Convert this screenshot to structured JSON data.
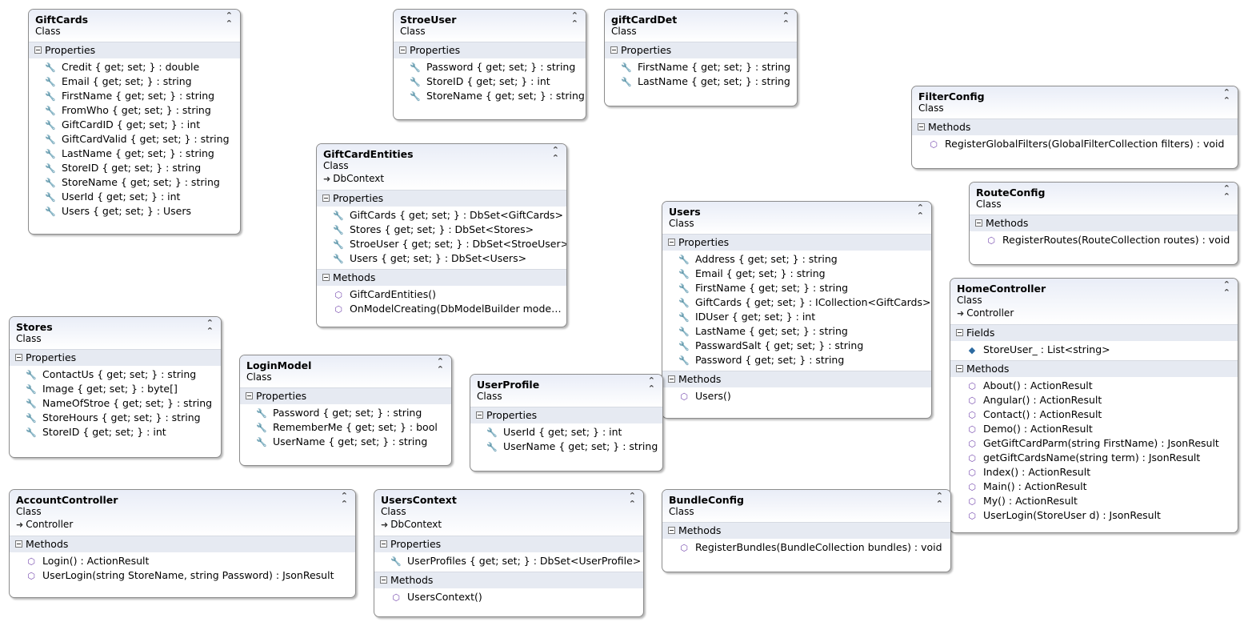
{
  "diagram": {
    "classes": [
      {
        "id": "giftcards",
        "name": "GiftCards",
        "stereotype": "Class",
        "base": "",
        "sections": [
          {
            "title": "Properties",
            "kind": "prop",
            "items": [
              "Credit { get; set; } : double",
              "Email { get; set; } : string",
              "FirstName { get; set; } : string",
              "FromWho { get; set; } : string",
              "GiftCardID { get; set; } : int",
              "GiftCardValid { get; set; } : string",
              "LastName { get; set; } : string",
              "StoreID { get; set; } : string",
              "StoreName { get; set; } : string",
              "UserId { get; set; } : int",
              "Users { get; set; } : Users"
            ]
          }
        ]
      },
      {
        "id": "stroeuser",
        "name": "StroeUser",
        "stereotype": "Class",
        "base": "",
        "sections": [
          {
            "title": "Properties",
            "kind": "prop",
            "items": [
              "Password { get; set; } : string",
              "StoreID { get; set; } : int",
              "StoreName { get; set; } : string"
            ]
          }
        ]
      },
      {
        "id": "giftcarddet",
        "name": "giftCardDet",
        "stereotype": "Class",
        "base": "",
        "sections": [
          {
            "title": "Properties",
            "kind": "privprop",
            "items": [
              "FirstName { get; set; } : string",
              "LastName { get; set; } : string"
            ]
          }
        ]
      },
      {
        "id": "filterconfig",
        "name": "FilterConfig",
        "stereotype": "Class",
        "base": "",
        "sections": [
          {
            "title": "Methods",
            "kind": "method",
            "items": [
              "RegisterGlobalFilters(GlobalFilterCollection filters) : void"
            ]
          }
        ]
      },
      {
        "id": "giftcardentities",
        "name": "GiftCardEntities",
        "stereotype": "Class",
        "base": "DbContext",
        "sections": [
          {
            "title": "Properties",
            "kind": "prop",
            "items": [
              "GiftCards { get; set; } : DbSet<GiftCards>",
              "Stores { get; set; } : DbSet<Stores>",
              "StroeUser { get; set; } : DbSet<StroeUser>",
              "Users { get; set; } : DbSet<Users>"
            ]
          },
          {
            "title": "Methods",
            "kind": "method",
            "items": [
              "GiftCardEntities()",
              "OnModelCreating(DbModelBuilder  mode…"
            ]
          }
        ]
      },
      {
        "id": "routeconfig",
        "name": "RouteConfig",
        "stereotype": "Class",
        "base": "",
        "sections": [
          {
            "title": "Methods",
            "kind": "method",
            "items": [
              "RegisterRoutes(RouteCollection routes) : void"
            ]
          }
        ]
      },
      {
        "id": "users",
        "name": "Users",
        "stereotype": "Class",
        "base": "",
        "sections": [
          {
            "title": "Properties",
            "kind": "prop",
            "items": [
              "Address { get; set; } : string",
              "Email { get; set; } : string",
              "FirstName { get; set; } : string",
              "GiftCards { get; set; } : ICollection<GiftCards>",
              "IDUser { get; set; } : int",
              "LastName { get; set; } : string",
              "PasswardSalt { get; set; } : string",
              "Password { get; set; } : string"
            ]
          },
          {
            "title": "Methods",
            "kind": "method",
            "items": [
              "Users()"
            ]
          }
        ]
      },
      {
        "id": "homecontroller",
        "name": "HomeController",
        "stereotype": "Class",
        "base": "Controller",
        "sections": [
          {
            "title": "Fields",
            "kind": "field",
            "items": [
              "StoreUser_ : List<string>"
            ]
          },
          {
            "title": "Methods",
            "kind": "method",
            "items": [
              "About() : ActionResult",
              "Angular() : ActionResult",
              "Contact() : ActionResult",
              "Demo() : ActionResult",
              "GetGiftCardParm(string FirstName) : JsonResult",
              "getGiftCardsName(string term) : JsonResult",
              "Index() : ActionResult",
              "Main() : ActionResult",
              "My() : ActionResult",
              "UserLogin(StoreUser d) : JsonResult"
            ]
          }
        ]
      },
      {
        "id": "stores",
        "name": "Stores",
        "stereotype": "Class",
        "base": "",
        "sections": [
          {
            "title": "Properties",
            "kind": "prop",
            "items": [
              "ContactUs { get; set; } : string",
              "Image { get; set; } : byte[]",
              "NameOfStroe { get; set; } : string",
              "StoreHours { get; set; } : string",
              "StoreID { get; set; } : int"
            ]
          }
        ]
      },
      {
        "id": "loginmodel",
        "name": "LoginModel",
        "stereotype": "Class",
        "base": "",
        "sections": [
          {
            "title": "Properties",
            "kind": "prop",
            "items": [
              "Password { get; set; } : string",
              "RememberMe { get; set; } : bool",
              "UserName { get; set; } : string"
            ]
          }
        ]
      },
      {
        "id": "userprofile",
        "name": "UserProfile",
        "stereotype": "Class",
        "base": "",
        "sections": [
          {
            "title": "Properties",
            "kind": "prop",
            "items": [
              "UserId { get; set; } : int",
              "UserName { get; set; } : string"
            ]
          }
        ]
      },
      {
        "id": "accountcontroller",
        "name": "AccountController",
        "stereotype": "Class",
        "base": "Controller",
        "sections": [
          {
            "title": "Methods",
            "kind": "method",
            "items": [
              "Login() : ActionResult",
              "UserLogin(string StoreName, string Password) : JsonResult"
            ]
          }
        ]
      },
      {
        "id": "userscontext",
        "name": "UsersContext",
        "stereotype": "Class",
        "base": "DbContext",
        "sections": [
          {
            "title": "Properties",
            "kind": "prop",
            "items": [
              "UserProfiles { get; set; } : DbSet<UserProfile>"
            ]
          },
          {
            "title": "Methods",
            "kind": "method",
            "items": [
              "UsersContext()"
            ]
          }
        ]
      },
      {
        "id": "bundleconfig",
        "name": "BundleConfig",
        "stereotype": "Class",
        "base": "",
        "sections": [
          {
            "title": "Methods",
            "kind": "method",
            "items": [
              "RegisterBundles(BundleCollection bundles) : void"
            ]
          }
        ]
      }
    ]
  }
}
